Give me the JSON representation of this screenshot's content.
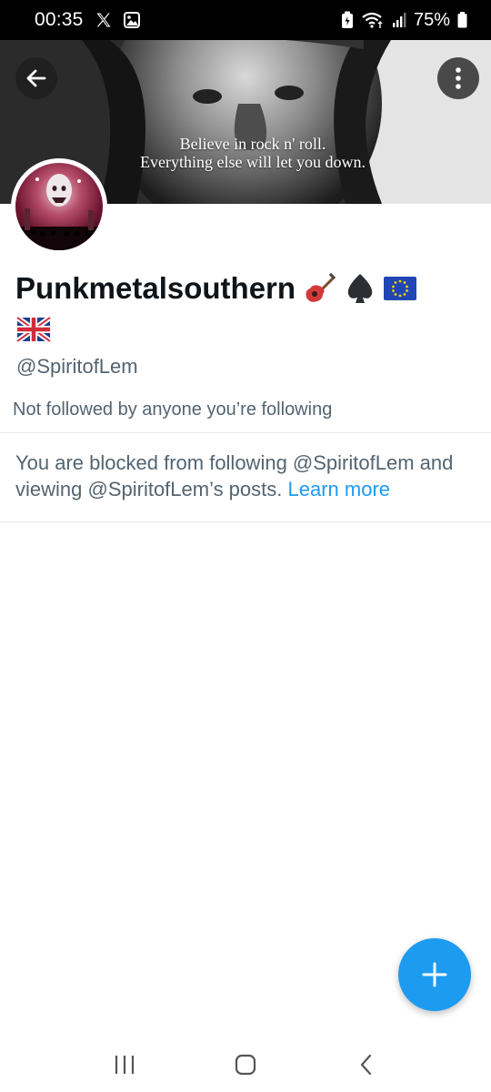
{
  "status_bar": {
    "time": "00:35",
    "battery_percent": "75%",
    "icons": [
      "x-logo-icon",
      "gallery-icon",
      "battery-saver-icon",
      "wifi-icon",
      "signal-icon",
      "battery-icon"
    ]
  },
  "banner": {
    "quote_line1": "Believe in rock n' roll.",
    "quote_line2": "Everything else will let you down."
  },
  "header": {
    "back_icon": "arrow-left-icon",
    "more_icon": "more-vertical-icon"
  },
  "profile": {
    "display_name": "Punkmetalsouthern",
    "name_emojis": [
      "guitar-emoji",
      "spade-emoji",
      "eu-flag-emoji",
      "uk-flag-emoji"
    ],
    "handle": "@SpiritofLem",
    "followers_context": "Not followed by anyone you’re following"
  },
  "blocked_notice": {
    "text": "You are blocked from following @SpiritofLem and viewing @SpiritofLem’s posts. ",
    "link_label": "Learn more"
  },
  "fab": {
    "icon": "plus-icon"
  },
  "nav_bar": {
    "icons": [
      "recent-apps-icon",
      "home-icon",
      "back-icon"
    ]
  },
  "colors": {
    "accent": "#1d9bf0",
    "text_primary": "#0f1419",
    "text_secondary": "#536471"
  }
}
